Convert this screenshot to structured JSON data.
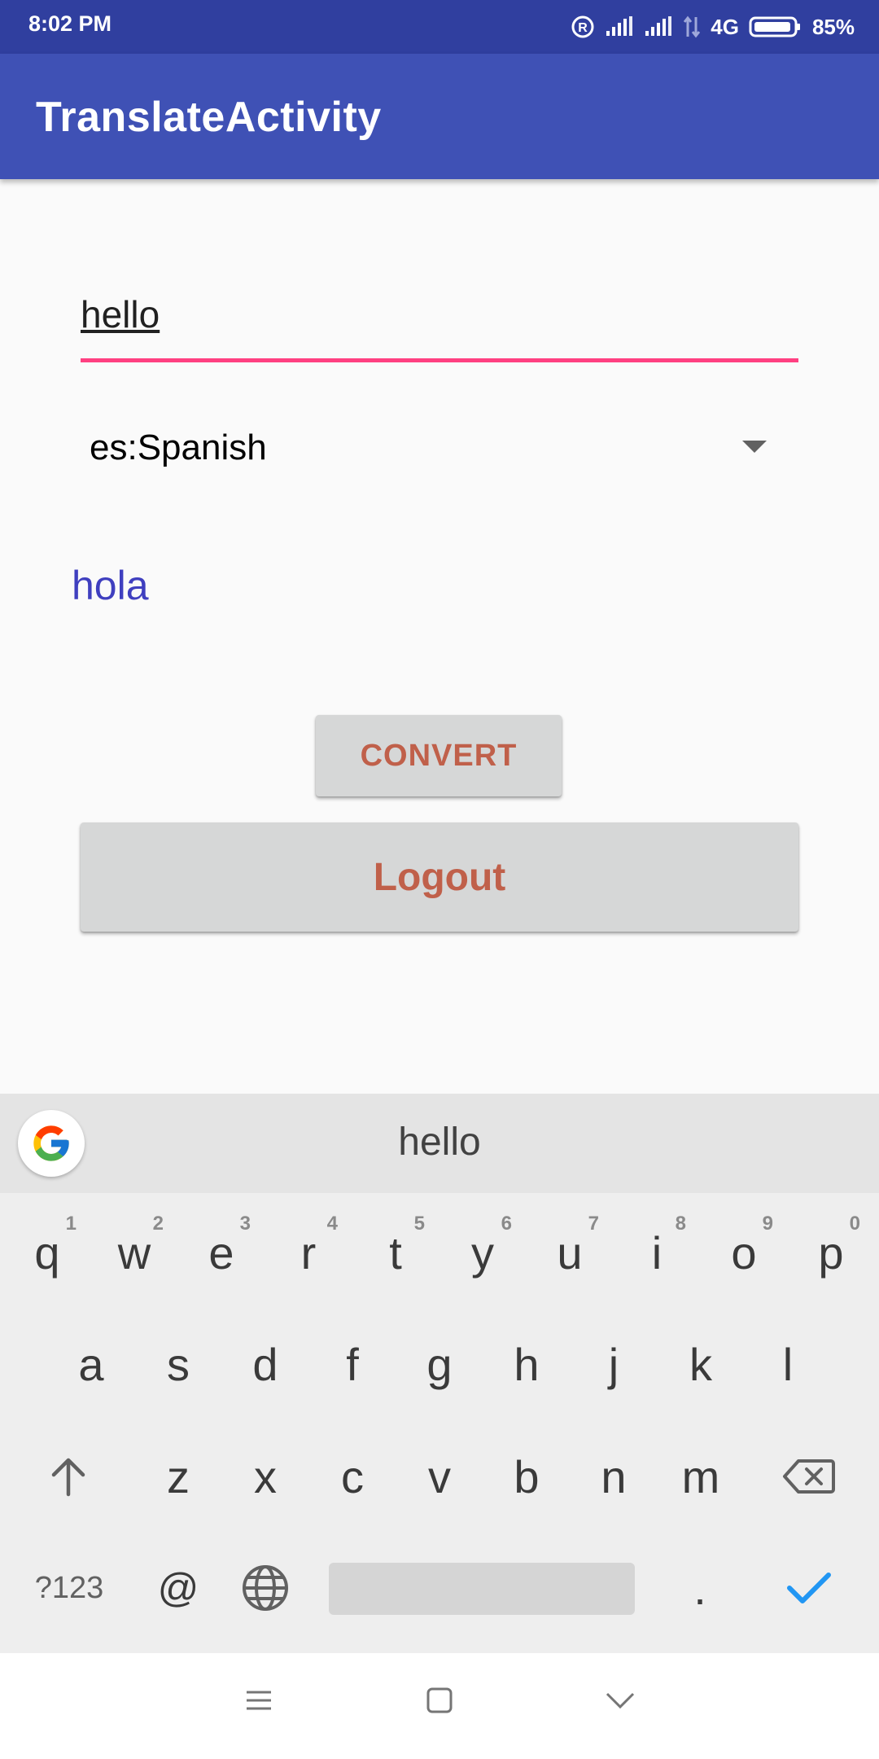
{
  "status_bar": {
    "time": "8:02 PM",
    "network": "4G",
    "battery": "85%"
  },
  "app_bar": {
    "title": "TranslateActivity"
  },
  "input": {
    "value": "hello"
  },
  "language_spinner": {
    "selected": "es:Spanish"
  },
  "result": {
    "text": "hola"
  },
  "buttons": {
    "convert": "CONVERT",
    "logout": "Logout"
  },
  "keyboard": {
    "suggestion": "hello",
    "row1": [
      {
        "key": "q",
        "hint": "1"
      },
      {
        "key": "w",
        "hint": "2"
      },
      {
        "key": "e",
        "hint": "3"
      },
      {
        "key": "r",
        "hint": "4"
      },
      {
        "key": "t",
        "hint": "5"
      },
      {
        "key": "y",
        "hint": "6"
      },
      {
        "key": "u",
        "hint": "7"
      },
      {
        "key": "i",
        "hint": "8"
      },
      {
        "key": "o",
        "hint": "9"
      },
      {
        "key": "p",
        "hint": "0"
      }
    ],
    "row2": [
      "a",
      "s",
      "d",
      "f",
      "g",
      "h",
      "j",
      "k",
      "l"
    ],
    "row3": [
      "z",
      "x",
      "c",
      "v",
      "b",
      "n",
      "m"
    ],
    "symbols_key": "?123",
    "at_key": "@",
    "period_key": ".",
    "colors": {
      "done_check": "#2196f3"
    }
  },
  "colors": {
    "status_bar": "#303f9f",
    "app_bar": "#3f51b5",
    "input_underline": "#ff4081",
    "result_text": "#3f3fbf",
    "button_text": "#c0604a"
  }
}
